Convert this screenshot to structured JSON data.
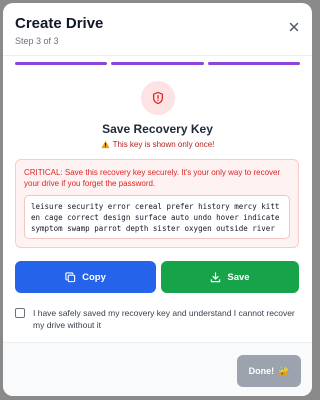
{
  "dialog": {
    "title": "Create Drive",
    "step_text": "Step 3 of 3",
    "step_progress": {
      "current": 3,
      "total": 3
    },
    "accent_color": "#8b47d6"
  },
  "recovery": {
    "heading": "Save Recovery Key",
    "warning": "This key is shown only once!",
    "critical_notice": "CRITICAL: Save this recovery key securely. It's your only way to recover your drive if you forget the password.",
    "key": "leisure security error cereal prefer history mercy kitten cage correct design surface auto undo hover indicate symptom swamp parrot depth sister oxygen outside river"
  },
  "buttons": {
    "copy_label": "Copy",
    "copy_color": "#2563eb",
    "save_label": "Save",
    "save_color": "#16a34a",
    "done_label": "Done!",
    "done_emoji": "🔐"
  },
  "confirmation": {
    "label": "I have safely saved my recovery key and understand I cannot recover my drive without it",
    "checked": false
  },
  "icons": {
    "close": "close-icon",
    "shield": "shield-icon",
    "warning": "warning-icon",
    "copy": "copy-icon",
    "download": "download-icon"
  }
}
